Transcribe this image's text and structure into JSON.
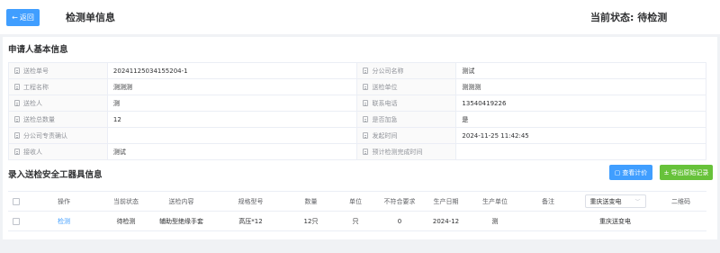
{
  "header": {
    "back_label": "返回",
    "title": "检测单信息",
    "status_text": "当前状态: 待检测"
  },
  "applicant": {
    "section_title": "申请人基本信息",
    "rows": [
      {
        "l1": "送检单号",
        "v1": "20241125034155204-1",
        "l2": "分公司名称",
        "v2": "测试"
      },
      {
        "l1": "工程名称",
        "v1": "测测测",
        "l2": "送检单位",
        "v2": "测测测"
      },
      {
        "l1": "送检人",
        "v1": "测",
        "l2": "联系电话",
        "v2": "13540419226"
      },
      {
        "l1": "送检总数量",
        "v1": "12",
        "l2": "是否加急",
        "v2": "是"
      },
      {
        "l1": "分公司专责确认",
        "v1": "",
        "l2": "发起时间",
        "v2": "2024-11-25 11:42:45"
      },
      {
        "l1": "接收人",
        "v1": "测试",
        "l2": "预计检测完成时间",
        "v2": ""
      }
    ]
  },
  "tools": {
    "section_title": "录入送检安全工器具信息",
    "view_price_label": "查看计价",
    "export_label": "导出原始记录",
    "columns": [
      "操作",
      "当前状态",
      "送检内容",
      "规格型号",
      "数量",
      "单位",
      "不符合要求",
      "生产日期",
      "生产单位",
      "备注",
      "",
      "二维码"
    ],
    "header_select": "重庆送变电",
    "rows": [
      {
        "action": "检测",
        "status": "待检测",
        "content": "辅助型绝缘手套",
        "spec": "高压*12",
        "qty": "12只",
        "unit": "只",
        "nonconform": "0",
        "date": "2024-12",
        "maker": "测",
        "remark": "",
        "company": "重庆送变电",
        "qrcode": ""
      }
    ]
  },
  "colors": {
    "primary": "#409eff",
    "success": "#67c23a"
  }
}
